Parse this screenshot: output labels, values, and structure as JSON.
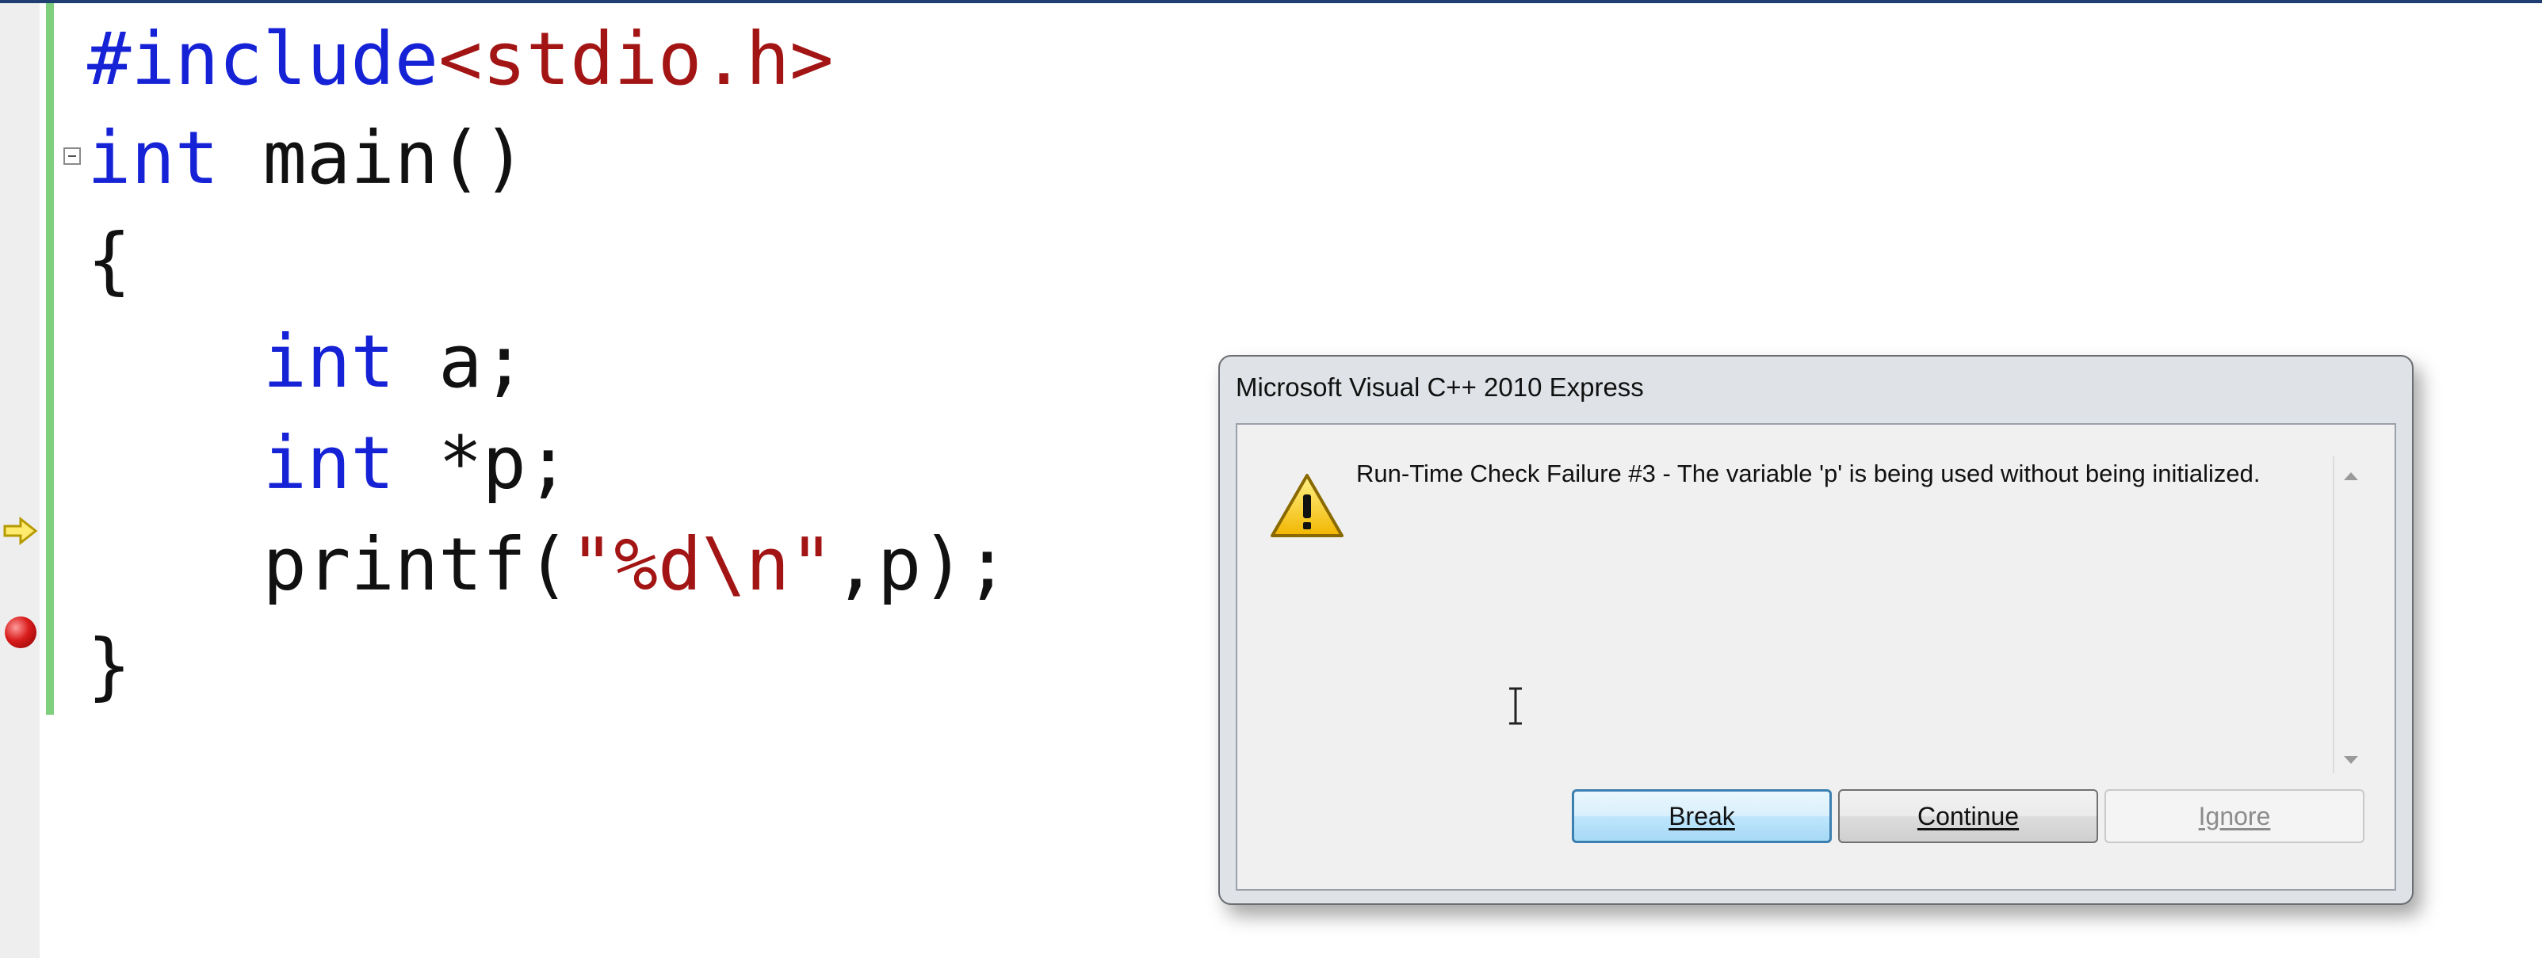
{
  "editor": {
    "lines": [
      {
        "parts": [
          {
            "t": "#include",
            "c": "pp"
          },
          {
            "t": "<stdio.h>",
            "c": "inc"
          }
        ]
      },
      {
        "parts": [
          {
            "t": "int",
            "c": "kw"
          },
          {
            "t": " main()",
            "c": ""
          }
        ]
      },
      {
        "parts": [
          {
            "t": "{",
            "c": ""
          }
        ]
      },
      {
        "parts": [
          {
            "t": "    ",
            "c": ""
          },
          {
            "t": "int",
            "c": "kw"
          },
          {
            "t": " a;",
            "c": ""
          }
        ]
      },
      {
        "parts": [
          {
            "t": "    ",
            "c": ""
          },
          {
            "t": "int",
            "c": "kw"
          },
          {
            "t": " *p;",
            "c": ""
          }
        ]
      },
      {
        "parts": [
          {
            "t": "    printf(",
            "c": ""
          },
          {
            "t": "\"%d\\n\"",
            "c": "str"
          },
          {
            "t": ",p);",
            "c": ""
          }
        ]
      },
      {
        "parts": [
          {
            "t": "}",
            "c": ""
          }
        ]
      }
    ],
    "keyword_color": "#1622d6",
    "string_color": "#a31515",
    "current_line_marker": "yellow-arrow-icon",
    "breakpoint_marker": "breakpoint-icon"
  },
  "dialog": {
    "title": "Microsoft Visual C++ 2010 Express",
    "message": "Run-Time Check Failure #3 - The variable 'p' is being used without being initialized.",
    "icon": "warning-icon",
    "buttons": {
      "break": "Break",
      "continue": "Continue",
      "ignore": "Ignore"
    }
  }
}
